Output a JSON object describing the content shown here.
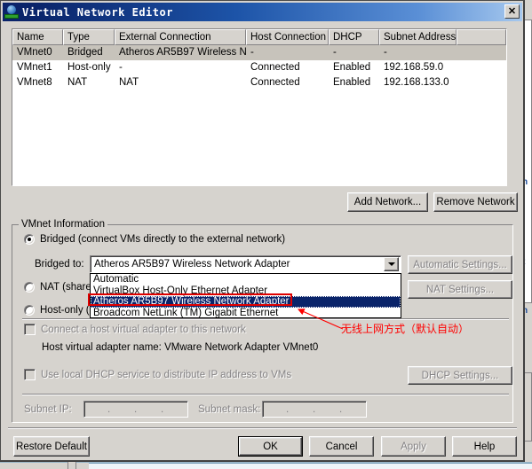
{
  "window": {
    "title": "Virtual Network Editor",
    "icon": "virtual-network-icon",
    "close_label": "✕"
  },
  "table": {
    "columns": [
      "Name",
      "Type",
      "External Connection",
      "Host Connection",
      "DHCP",
      "Subnet Address",
      ""
    ],
    "rows": [
      {
        "name": "VMnet0",
        "type": "Bridged",
        "external": "Atheros AR5B97 Wireless N...",
        "host": "-",
        "dhcp": "-",
        "subnet": "-",
        "selected": true
      },
      {
        "name": "VMnet1",
        "type": "Host-only",
        "external": "-",
        "host": "Connected",
        "dhcp": "Enabled",
        "subnet": "192.168.59.0",
        "selected": false
      },
      {
        "name": "VMnet8",
        "type": "NAT",
        "external": "NAT",
        "host": "Connected",
        "dhcp": "Enabled",
        "subnet": "192.168.133.0",
        "selected": false
      }
    ]
  },
  "table_buttons": {
    "add_network": "Add Network...",
    "remove_network": "Remove Network"
  },
  "vmnet_info": {
    "group_title": "VMnet Information",
    "radios": [
      {
        "label": "Bridged (connect VMs directly to the external network)",
        "checked": true,
        "disabled": false
      },
      {
        "label": "NAT (shared",
        "checked": false,
        "disabled": false
      },
      {
        "label": "Host-only (co",
        "checked": false,
        "disabled": false
      }
    ],
    "bridged_to_label": "Bridged to:",
    "bridged_to_value": "Atheros AR5B97 Wireless Network Adapter",
    "dropdown_options": [
      "Automatic",
      "VirtualBox Host-Only Ethernet Adapter",
      "Atheros AR5B97 Wireless Network Adapter",
      "Broadcom NetLink (TM) Gigabit Ethernet"
    ],
    "dropdown_selected_index": 2,
    "automatic_settings": "Automatic Settings...",
    "nat_settings": "NAT Settings...",
    "dhcp_settings": "DHCP Settings...",
    "connect_host_adapter": "Connect a host virtual adapter to this network",
    "host_adapter_name": "Host virtual adapter name: VMware Network Adapter VMnet0",
    "use_local_dhcp": "Use local DHCP service to distribute IP address to VMs",
    "subnet_ip_label": "Subnet IP:",
    "subnet_mask_label": "Subnet mask:",
    "subnet_ip_value": ".    .    .",
    "subnet_mask_value": ".    .    ."
  },
  "annotation": {
    "text": "无线上网方式（默认自动）",
    "color": "#ff0000",
    "highlight_color": "#e00000"
  },
  "footer": {
    "restore_default": "Restore Default",
    "ok": "OK",
    "cancel": "Cancel",
    "apply": "Apply",
    "help": "Help"
  },
  "background": {
    "text1": "n",
    "text2": "t",
    "text3": "n"
  },
  "colors": {
    "face": "#d6d3ce",
    "titlebar_start": "#0a246a",
    "titlebar_end": "#a6c8ee",
    "selection": "#0a246a",
    "row_selected": "#c7c3bb"
  }
}
